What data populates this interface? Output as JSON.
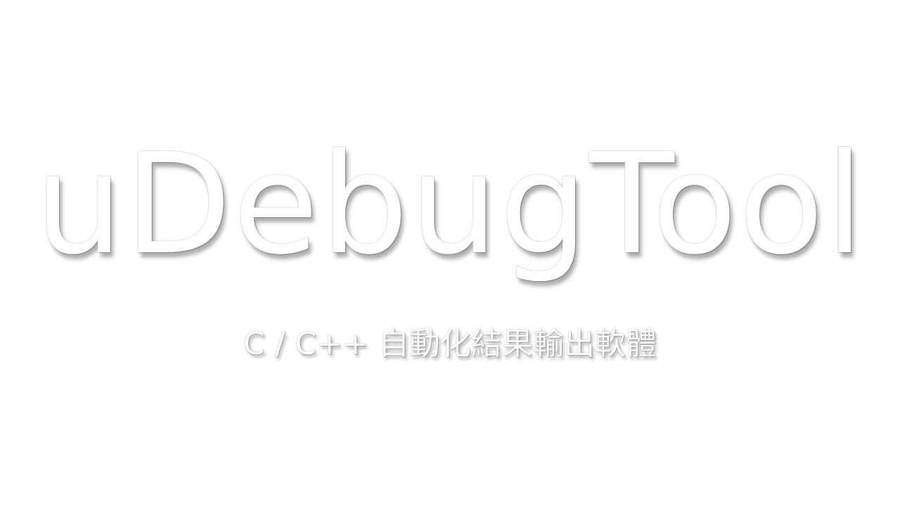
{
  "splash": {
    "title": "uDebugTool",
    "subtitle": "C / C++ 自動化結果輸出軟體",
    "background_color": "#ffffff",
    "text_color": "#ffffff"
  }
}
